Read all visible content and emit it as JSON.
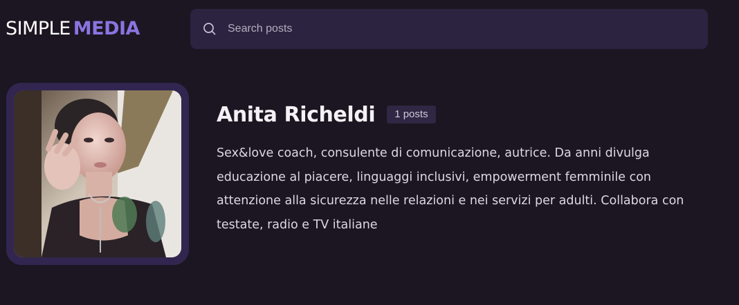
{
  "brand": {
    "part1": "SIMPLE",
    "part2": "MEDIA",
    "accent_color": "#8b73e0"
  },
  "search": {
    "placeholder": "Search posts",
    "value": "",
    "icon": "search-icon"
  },
  "author": {
    "name": "Anita Richeldi",
    "post_count_label": "1 posts",
    "bio": "Sex&love coach, consulente di comunicazione, autrice. Da anni divulga educazione al piacere, linguaggi inclusivi, empowerment femminile con attenzione alla sicurezza nelle relazioni e nei servizi per adulti. Collabora con testate, radio e TV italiane"
  },
  "colors": {
    "background": "#1b1621",
    "search_bg": "#2c2340",
    "avatar_frame": "#322650",
    "badge_bg": "#2f2743"
  }
}
